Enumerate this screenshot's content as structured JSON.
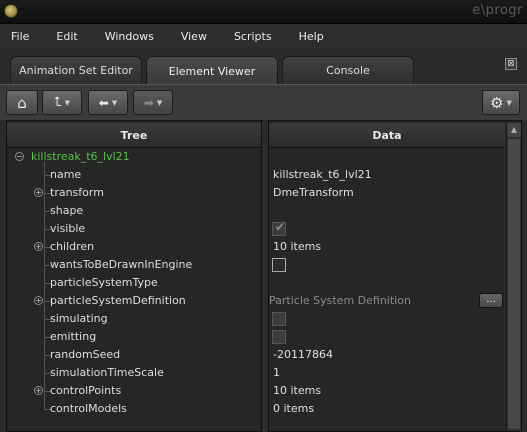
{
  "window": {
    "title_text": "e\\progr"
  },
  "menu": [
    "File",
    "Edit",
    "Windows",
    "View",
    "Scripts",
    "Help"
  ],
  "tabs": [
    {
      "label": "Animation Set Editor",
      "active": false
    },
    {
      "label": "Element Viewer",
      "active": true
    },
    {
      "label": "Console",
      "active": false
    }
  ],
  "pin_glyph": "⊠",
  "toolbar": {
    "home": "⌂",
    "up": "⮤",
    "back": "⬅",
    "forward": "➡",
    "settings": "⚙",
    "drop": "▼"
  },
  "tree": {
    "header": "Tree",
    "root": {
      "label": "killstreak_t6_lvl21",
      "expander": "−"
    },
    "children": [
      {
        "label": "name",
        "expandable": false
      },
      {
        "label": "transform",
        "expandable": true
      },
      {
        "label": "shape",
        "expandable": false
      },
      {
        "label": "visible",
        "expandable": false
      },
      {
        "label": "children",
        "expandable": true
      },
      {
        "label": "wantsToBeDrawnInEngine",
        "expandable": false
      },
      {
        "label": "particleSystemType",
        "expandable": false
      },
      {
        "label": "particleSystemDefinition",
        "expandable": true
      },
      {
        "label": "simulating",
        "expandable": false
      },
      {
        "label": "emitting",
        "expandable": false
      },
      {
        "label": "randomSeed",
        "expandable": false
      },
      {
        "label": "simulationTimeScale",
        "expandable": false
      },
      {
        "label": "controlPoints",
        "expandable": true
      },
      {
        "label": "controlModels",
        "expandable": false
      }
    ]
  },
  "data_panel": {
    "header": "Data",
    "rows": [
      {
        "kind": "text",
        "value": ""
      },
      {
        "kind": "text",
        "value": "killstreak_t6_lvl21"
      },
      {
        "kind": "text",
        "value": "DmeTransform"
      },
      {
        "kind": "text",
        "value": ""
      },
      {
        "kind": "checkbox",
        "checked": true,
        "enabled": false
      },
      {
        "kind": "text",
        "value": "10 items"
      },
      {
        "kind": "checkbox",
        "checked": false,
        "enabled": true
      },
      {
        "kind": "text",
        "value": ""
      },
      {
        "kind": "button",
        "value": "Particle System Definition",
        "button_label": "..."
      },
      {
        "kind": "checkbox",
        "checked": false,
        "enabled": false
      },
      {
        "kind": "checkbox",
        "checked": false,
        "enabled": false
      },
      {
        "kind": "text",
        "value": "-20117864"
      },
      {
        "kind": "text",
        "value": "1"
      },
      {
        "kind": "text",
        "value": "10 items"
      },
      {
        "kind": "text",
        "value": "0 items"
      }
    ]
  },
  "colors": {
    "root_label": "#54c24a",
    "background": "#2b2b2b"
  }
}
